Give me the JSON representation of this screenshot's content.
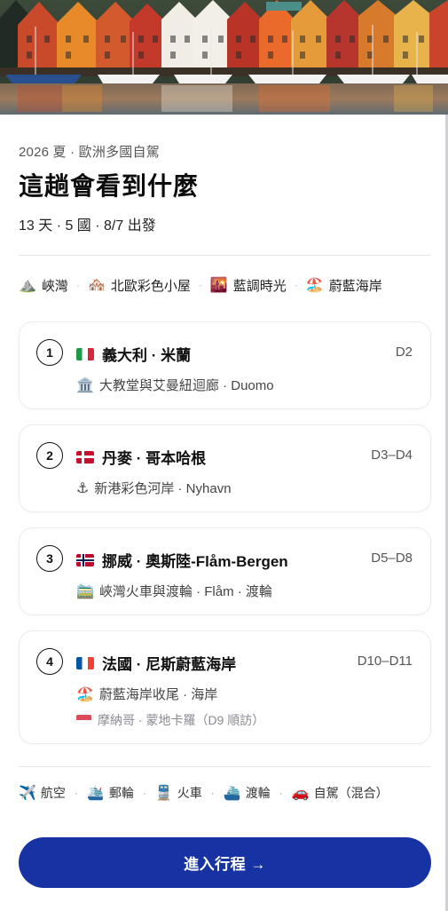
{
  "hero": {
    "alt_icon": "bergen-harbor-photo"
  },
  "header": {
    "subtitle": "2026 夏 · 歐洲多國自駕",
    "title": "這趟會看到什麼",
    "meta": "13 天 · 5 國 · 8/7 出發"
  },
  "highlights": [
    {
      "icon": "⛰️",
      "label": "峽灣"
    },
    {
      "icon": "🏘️",
      "label": "北歐彩色小屋"
    },
    {
      "icon": "🌇",
      "label": "藍調時光"
    },
    {
      "icon": "🏖️",
      "label": "蔚藍海岸"
    }
  ],
  "stops": [
    {
      "num": "1",
      "flag": "it",
      "name": "義大利 · 米蘭",
      "days": "D2",
      "sub_icon": "🏛️",
      "sub": "大教堂與艾曼紐迴廊 · Duomo",
      "note": ""
    },
    {
      "num": "2",
      "flag": "dk",
      "name": "丹麥 · 哥本哈根",
      "days": "D3–D4",
      "sub_icon": "⚓",
      "sub": "新港彩色河岸 · Nyhavn",
      "note": ""
    },
    {
      "num": "3",
      "flag": "no",
      "name": "挪威 · 奧斯陸-Flåm-Bergen",
      "days": "D5–D8",
      "sub_icon": "🚞",
      "sub": "峽灣火車與渡輪 · Flåm · 渡輪",
      "note": ""
    },
    {
      "num": "4",
      "flag": "fr",
      "name": "法國 · 尼斯蔚藍海岸",
      "days": "D10–D11",
      "sub_icon": "🏖️",
      "sub": "蔚藍海岸收尾 · 海岸",
      "note": "摩納哥 · 蒙地卡羅（D9 順訪）"
    }
  ],
  "transport": [
    {
      "icon": "✈️",
      "label": "航空"
    },
    {
      "icon": "🛳️",
      "label": "郵輪"
    },
    {
      "icon": "🚆",
      "label": "火車"
    },
    {
      "icon": "⛴️",
      "label": "渡輪"
    },
    {
      "icon": "🚗",
      "label": "自駕（混合）"
    }
  ],
  "cta": {
    "label": "進入行程 →"
  },
  "colors": {
    "accent": "#1733a3",
    "border": "#ececf0",
    "muted": "#8a8a93"
  }
}
